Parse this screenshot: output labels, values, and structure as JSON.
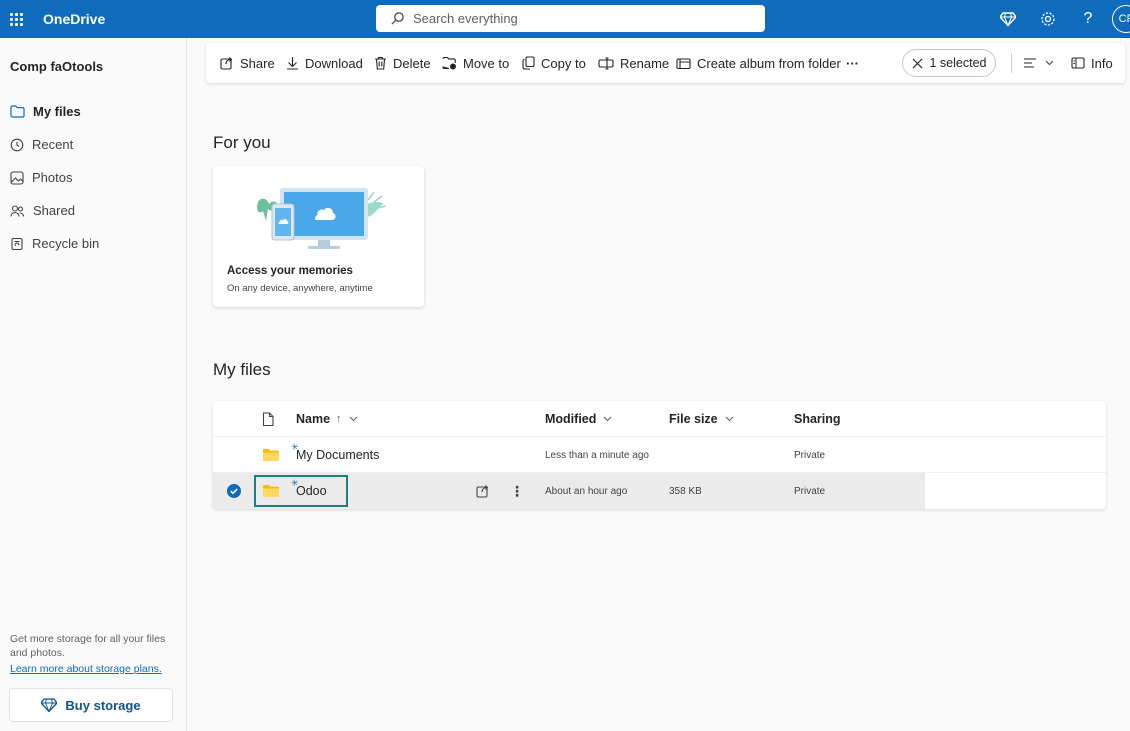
{
  "topbar": {
    "app_title": "OneDrive",
    "search_placeholder": "Search everything",
    "avatar_initials": "CF",
    "icons": [
      "waffle-icon",
      "premium-diamond-icon",
      "settings-gear-icon",
      "help-icon"
    ]
  },
  "sidebar": {
    "account_name": "Comp faOtools",
    "items": [
      {
        "label": "My files",
        "icon": "folder-icon",
        "active": true
      },
      {
        "label": "Recent",
        "icon": "clock-icon",
        "active": false
      },
      {
        "label": "Photos",
        "icon": "photo-icon",
        "active": false
      },
      {
        "label": "Shared",
        "icon": "people-icon",
        "active": false
      },
      {
        "label": "Recycle bin",
        "icon": "recycle-bin-icon",
        "active": false
      }
    ],
    "promo_text": "Get more storage for all your files and photos.",
    "promo_link": "Learn more about storage plans.",
    "buy_button": "Buy storage"
  },
  "commandbar": {
    "share": "Share",
    "download": "Download",
    "delete": "Delete",
    "move_to": "Move to",
    "copy_to": "Copy to",
    "rename": "Rename",
    "create_album": "Create album from folder",
    "more": "···",
    "selected": "1 selected",
    "info": "Info"
  },
  "for_you": {
    "heading": "For you",
    "card_title": "Access your memories",
    "card_subtitle": "On any device, anywhere, anytime"
  },
  "my_files": {
    "heading": "My files",
    "columns": {
      "name": "Name",
      "name_sort": "↑",
      "modified": "Modified",
      "file_size": "File size",
      "sharing": "Sharing"
    },
    "rows": [
      {
        "name": "My Documents",
        "modified": "Less than a minute ago",
        "size": "",
        "sharing": "Private",
        "selected": false
      },
      {
        "name": "Odoo",
        "modified": "About an hour ago",
        "size": "358 KB",
        "sharing": "Private",
        "selected": true
      }
    ]
  },
  "colors": {
    "brand": "#0f6cbd",
    "folder": "#ffb900",
    "highlight": "#1e7f80"
  }
}
